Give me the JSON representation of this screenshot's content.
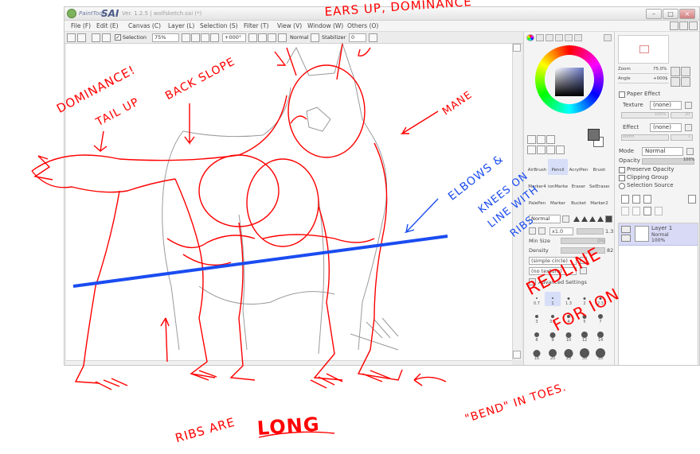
{
  "window": {
    "app_logo_sub": "PaintTool",
    "app_logo": "SAI",
    "doc_title": "Ver. 1.2.5 | wolfsketch.sai (*)",
    "controls": {
      "minimize": "–",
      "maximize": "□",
      "close": "×"
    }
  },
  "menu": {
    "items": [
      {
        "label": "File (F)"
      },
      {
        "label": "Edit (E)"
      },
      {
        "label": "Canvas (C)"
      },
      {
        "label": "Layer (L)"
      },
      {
        "label": "Selection (S)"
      },
      {
        "label": "Filter (T)"
      },
      {
        "label": "View (V)"
      },
      {
        "label": "Window (W)"
      },
      {
        "label": "Others (O)"
      }
    ]
  },
  "toolbar": {
    "selection_label": "Selection",
    "zoom_value": "75%",
    "rotation_value": "+000°",
    "blend_value": "Normal",
    "stabilizer_label": "Stabilizer",
    "stabilizer_value": "0"
  },
  "tools": {
    "grid": [
      "AirBrush",
      "Pencil",
      "AcrylPen",
      "Brush",
      "Marker4",
      "ionMarker",
      "Eraser",
      "SelEraser",
      "PalePen",
      "Marker",
      "Bucket",
      "Marker2"
    ],
    "selected_index": 1
  },
  "brush": {
    "blend_mode": "Normal",
    "size_multiplier": "x1.0",
    "size_value": "1.3",
    "min_size_label": "Min Size",
    "min_size_value": "0%",
    "density_label": "Density",
    "density_value": "82",
    "shape_value": "(simple circle)",
    "texture_value": "(no texture)",
    "advanced_label": "Advanced Settings",
    "sizes": [
      "0.7",
      "1",
      "1.3",
      "2",
      "2.3",
      "3",
      "3.5",
      "4",
      "5",
      "7",
      "8",
      "9",
      "10",
      "12",
      "14",
      "16",
      "20",
      "25",
      "30",
      "35"
    ],
    "selected_size_index": 1
  },
  "navigator": {
    "zoom_label": "Zoom",
    "zoom_value": "75.0%",
    "angle_label": "Angle",
    "angle_value": "+000$"
  },
  "paper_effect": {
    "header": "Paper Effect",
    "texture_label": "Texture",
    "texture_value": "(none)",
    "texture_scale": "100%",
    "texture_strength": "20",
    "effect_label": "Effect",
    "effect_value": "(none)",
    "effect_width": "Width",
    "effect_strength": "1"
  },
  "layer_props": {
    "mode_label": "Mode",
    "mode_value": "Normal",
    "opacity_label": "Opacity",
    "opacity_value": "100%",
    "preserve_opacity": "Preserve Opacity",
    "clipping_group": "Clipping Group",
    "selection_source": "Selection Source"
  },
  "layers": [
    {
      "name": "Layer 1",
      "mode": "Normal",
      "opacity": "100%"
    }
  ],
  "annotations": {
    "dominance_tail": "DOMINANCE!",
    "tail_up": "TAIL UP",
    "back_slope": "BACK SLOPE",
    "ears_up": "EARS UP, DOMINANCE",
    "mane": "MANE",
    "elbows": "ELBOWS &",
    "knees": "KNEES ON",
    "line_with": "LINE WITH",
    "ribs_short": "RIBS",
    "redline": "REDLINE",
    "for_ion": "FOR ION",
    "ribs_are": "RIBS ARE",
    "long": "LONG",
    "bend": "\"BEND\" IN TOES.",
    "blue_line_color": "#1a4cf0",
    "red_color": "#ff0000"
  }
}
